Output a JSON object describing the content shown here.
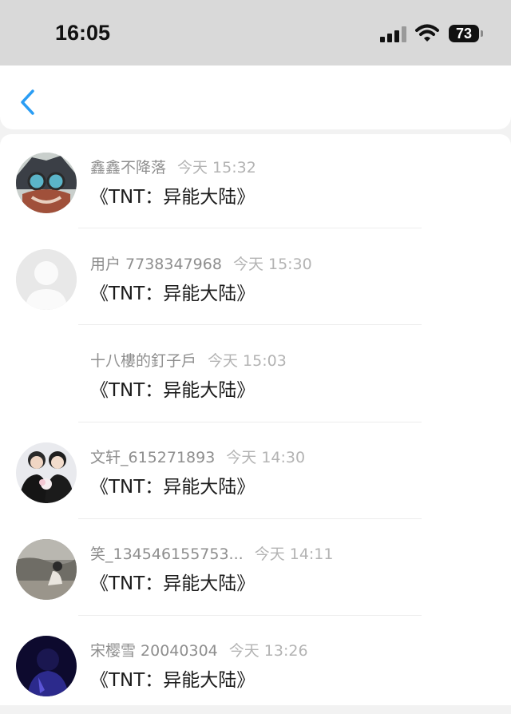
{
  "status_bar": {
    "time": "16:05",
    "battery": "73",
    "icons": [
      "cellular-signal-icon",
      "wifi-icon",
      "battery-icon"
    ]
  },
  "nav": {
    "back_icon": "chevron-left-icon",
    "accent_color": "#2a9df4"
  },
  "messages": [
    {
      "name": "鑫鑫不降落",
      "time": "今天 15:32",
      "text": "《TNT：异能大陆》",
      "avatar": "cartoon-character"
    },
    {
      "name": "用户 7738347968",
      "time": "今天 15:30",
      "text": "《TNT：异能大陆》",
      "avatar": "default-gray-person"
    },
    {
      "name": "十八樓的釘子戶",
      "time": "今天 15:03",
      "text": "《TNT：异能大陆》",
      "avatar": "none"
    },
    {
      "name": "文轩_615271893",
      "time": "今天 14:30",
      "text": "《TNT：异能大陆》",
      "avatar": "two-people-photo"
    },
    {
      "name": "笑_134546155753...",
      "time": "今天 14:11",
      "text": "《TNT：异能大陆》",
      "avatar": "person-by-sea-photo"
    },
    {
      "name": "宋樱雪 20040304",
      "time": "今天 13:26",
      "text": "《TNT：异能大陆》",
      "avatar": "dark-blue-portrait"
    }
  ]
}
